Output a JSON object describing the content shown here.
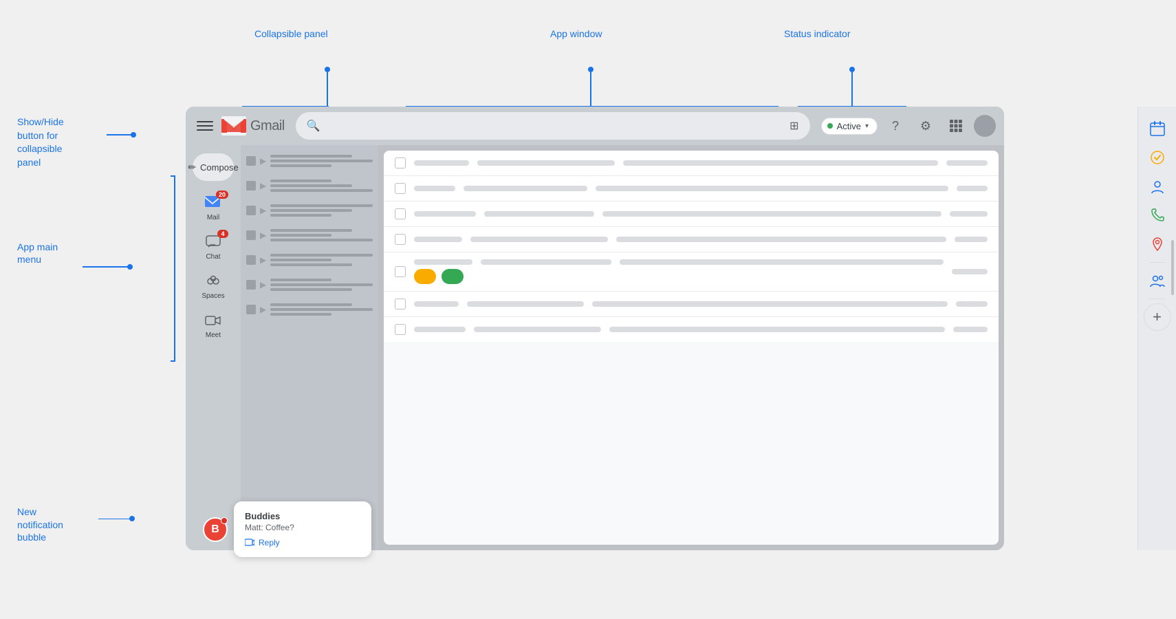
{
  "annotations": {
    "collapsible_panel": "Collapsible panel",
    "app_window": "App window",
    "status_indicator": "Status indicator",
    "show_hide_button": "Show/Hide\nbutton for\ncollapsible\npanel",
    "app_main_menu": "App main\nmenu",
    "new_notification": "New\nnotification\nbubble"
  },
  "header": {
    "menu_label": "menu",
    "logo_text": "Gmail",
    "search_placeholder": "",
    "status": {
      "label": "Active",
      "dot_color": "#34a853"
    },
    "help_icon": "?",
    "settings_icon": "⚙",
    "grid_icon": "⠿",
    "avatar_color": "#9aa0a6"
  },
  "nav": {
    "compose_label": "Compose",
    "items": [
      {
        "id": "mail",
        "label": "Mail",
        "badge": "20",
        "icon": "✉"
      },
      {
        "id": "chat",
        "label": "Chat",
        "badge": "4",
        "icon": "💬"
      },
      {
        "id": "spaces",
        "label": "Spaces",
        "badge": "",
        "icon": "👥"
      },
      {
        "id": "meet",
        "label": "Meet",
        "badge": "",
        "icon": "📹"
      }
    ]
  },
  "email_rows": [
    {
      "id": 1,
      "lines": [
        "short",
        "medium",
        "full"
      ]
    },
    {
      "id": 2,
      "lines": [
        "short",
        "medium",
        "full"
      ]
    },
    {
      "id": 3,
      "lines": [
        "short",
        "medium",
        "full"
      ]
    },
    {
      "id": 4,
      "lines": [
        "short",
        "medium",
        "full"
      ]
    },
    {
      "id": 5,
      "lines": [
        "short",
        "medium",
        "full"
      ]
    },
    {
      "id": 6,
      "lines": [
        "short",
        "medium",
        "full"
      ]
    },
    {
      "id": 7,
      "lines": [
        "short",
        "medium",
        "full"
      ]
    }
  ],
  "email_items": [
    {
      "id": 1,
      "sender_width": 80,
      "subject_width": 200,
      "preview_width": 300,
      "date_width": 50,
      "tags": false
    },
    {
      "id": 2,
      "sender_width": 60,
      "subject_width": 180,
      "preview_width": 280,
      "date_width": 45,
      "tags": false
    },
    {
      "id": 3,
      "sender_width": 90,
      "subject_width": 160,
      "preview_width": 260,
      "date_width": 55,
      "tags": false
    },
    {
      "id": 4,
      "sender_width": 70,
      "subject_width": 200,
      "preview_width": 300,
      "date_width": 48,
      "tags": false
    },
    {
      "id": 5,
      "sender_width": 85,
      "subject_width": 190,
      "preview_width": 270,
      "date_width": 52,
      "tags": true
    },
    {
      "id": 6,
      "sender_width": 65,
      "subject_width": 170,
      "preview_width": 290,
      "date_width": 46,
      "tags": false
    },
    {
      "id": 7,
      "sender_width": 75,
      "subject_width": 185,
      "preview_width": 285,
      "date_width": 50,
      "tags": false
    }
  ],
  "right_sidebar": {
    "apps": [
      {
        "id": "calendar",
        "color": "#1a73e8",
        "unicode": "📅"
      },
      {
        "id": "tasks",
        "color": "#f9ab00",
        "unicode": "✓"
      },
      {
        "id": "contacts",
        "color": "#1a73e8",
        "unicode": "👤"
      },
      {
        "id": "phone",
        "color": "#34a853",
        "unicode": "📞"
      },
      {
        "id": "maps",
        "color": "#ea4335",
        "unicode": "📍"
      },
      {
        "id": "people",
        "color": "#1a73e8",
        "unicode": "👥"
      }
    ],
    "add_label": "+"
  },
  "notification": {
    "title": "Buddies",
    "body": "Matt: Coffee?",
    "reply_label": "Reply",
    "avatar_letter": "B",
    "avatar_bg": "#ea4335"
  },
  "status_indicator": {
    "label": "Active",
    "active_color": "#34a853"
  }
}
